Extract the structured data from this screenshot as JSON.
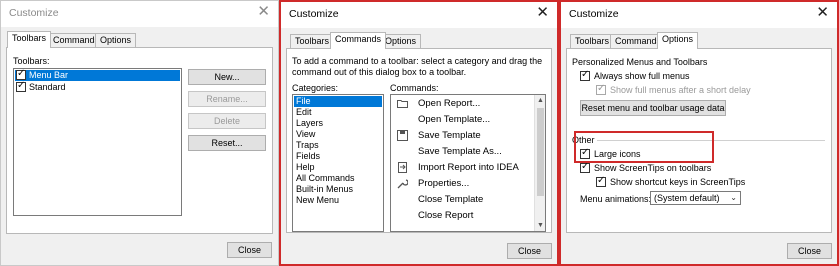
{
  "dialogs": [
    {
      "title": "Customize",
      "active": false,
      "close_glyph": "✕",
      "tabs": [
        {
          "label": "Toolbars",
          "active": true
        },
        {
          "label": "Commands",
          "active": false
        },
        {
          "label": "Options",
          "active": false
        }
      ],
      "toolbars_label": "Toolbars:",
      "toolbars": [
        {
          "label": "Menu Bar",
          "checked": true,
          "selected": true
        },
        {
          "label": "Standard",
          "checked": true,
          "selected": false
        }
      ],
      "buttons": {
        "new": "New...",
        "rename": "Rename...",
        "delete": "Delete",
        "reset": "Reset..."
      },
      "close_button": "Close"
    },
    {
      "title": "Customize",
      "active": true,
      "close_glyph": "✕",
      "tabs": [
        {
          "label": "Toolbars",
          "active": false
        },
        {
          "label": "Commands",
          "active": true
        },
        {
          "label": "Options",
          "active": false
        }
      ],
      "instructions": [
        "To add a command to a toolbar: select a category and drag the",
        "command out of this dialog box to a toolbar."
      ],
      "categories_label": "Categories:",
      "commands_label": "Commands:",
      "categories": [
        "File",
        "Edit",
        "Layers",
        "View",
        "Traps",
        "Fields",
        "Help",
        "All Commands",
        "Built-in Menus",
        "New Menu"
      ],
      "selected_category": "File",
      "commands": [
        {
          "label": "Open Report...",
          "icon": "open-folder-icon"
        },
        {
          "label": "Open Template...",
          "icon": ""
        },
        {
          "label": "Save Template",
          "icon": "save-icon"
        },
        {
          "label": "Save Template As...",
          "icon": ""
        },
        {
          "label": "Import Report into IDEA",
          "icon": "import-icon"
        },
        {
          "label": "Properties...",
          "icon": "wrench-icon"
        },
        {
          "label": "Close Template",
          "icon": ""
        },
        {
          "label": "Close Report",
          "icon": ""
        }
      ],
      "close_button": "Close"
    },
    {
      "title": "Customize",
      "active": true,
      "close_glyph": "✕",
      "tabs": [
        {
          "label": "Toolbars",
          "active": false
        },
        {
          "label": "Commands",
          "active": false
        },
        {
          "label": "Options",
          "active": true
        }
      ],
      "personalized_heading": "Personalized Menus and Toolbars",
      "always_show_full_menus": {
        "label": "Always show full menus",
        "checked": true,
        "enabled": true
      },
      "show_full_after_delay": {
        "label": "Show full menus after a short delay",
        "checked": true,
        "enabled": false
      },
      "reset_usage_button": "Reset menu and toolbar usage data",
      "other_heading": "Other",
      "large_icons": {
        "label": "Large icons",
        "checked": true,
        "enabled": true
      },
      "show_screentips": {
        "label": "Show ScreenTips on toolbars",
        "checked": true,
        "enabled": true
      },
      "show_shortcut_keys": {
        "label": "Show shortcut keys in ScreenTips",
        "checked": true,
        "enabled": true
      },
      "menu_animations_label": "Menu animations:",
      "menu_animations_value": "(System default)",
      "close_button": "Close"
    }
  ],
  "colors": {
    "highlight": "#cf2a2a",
    "selection": "#0078d7"
  }
}
